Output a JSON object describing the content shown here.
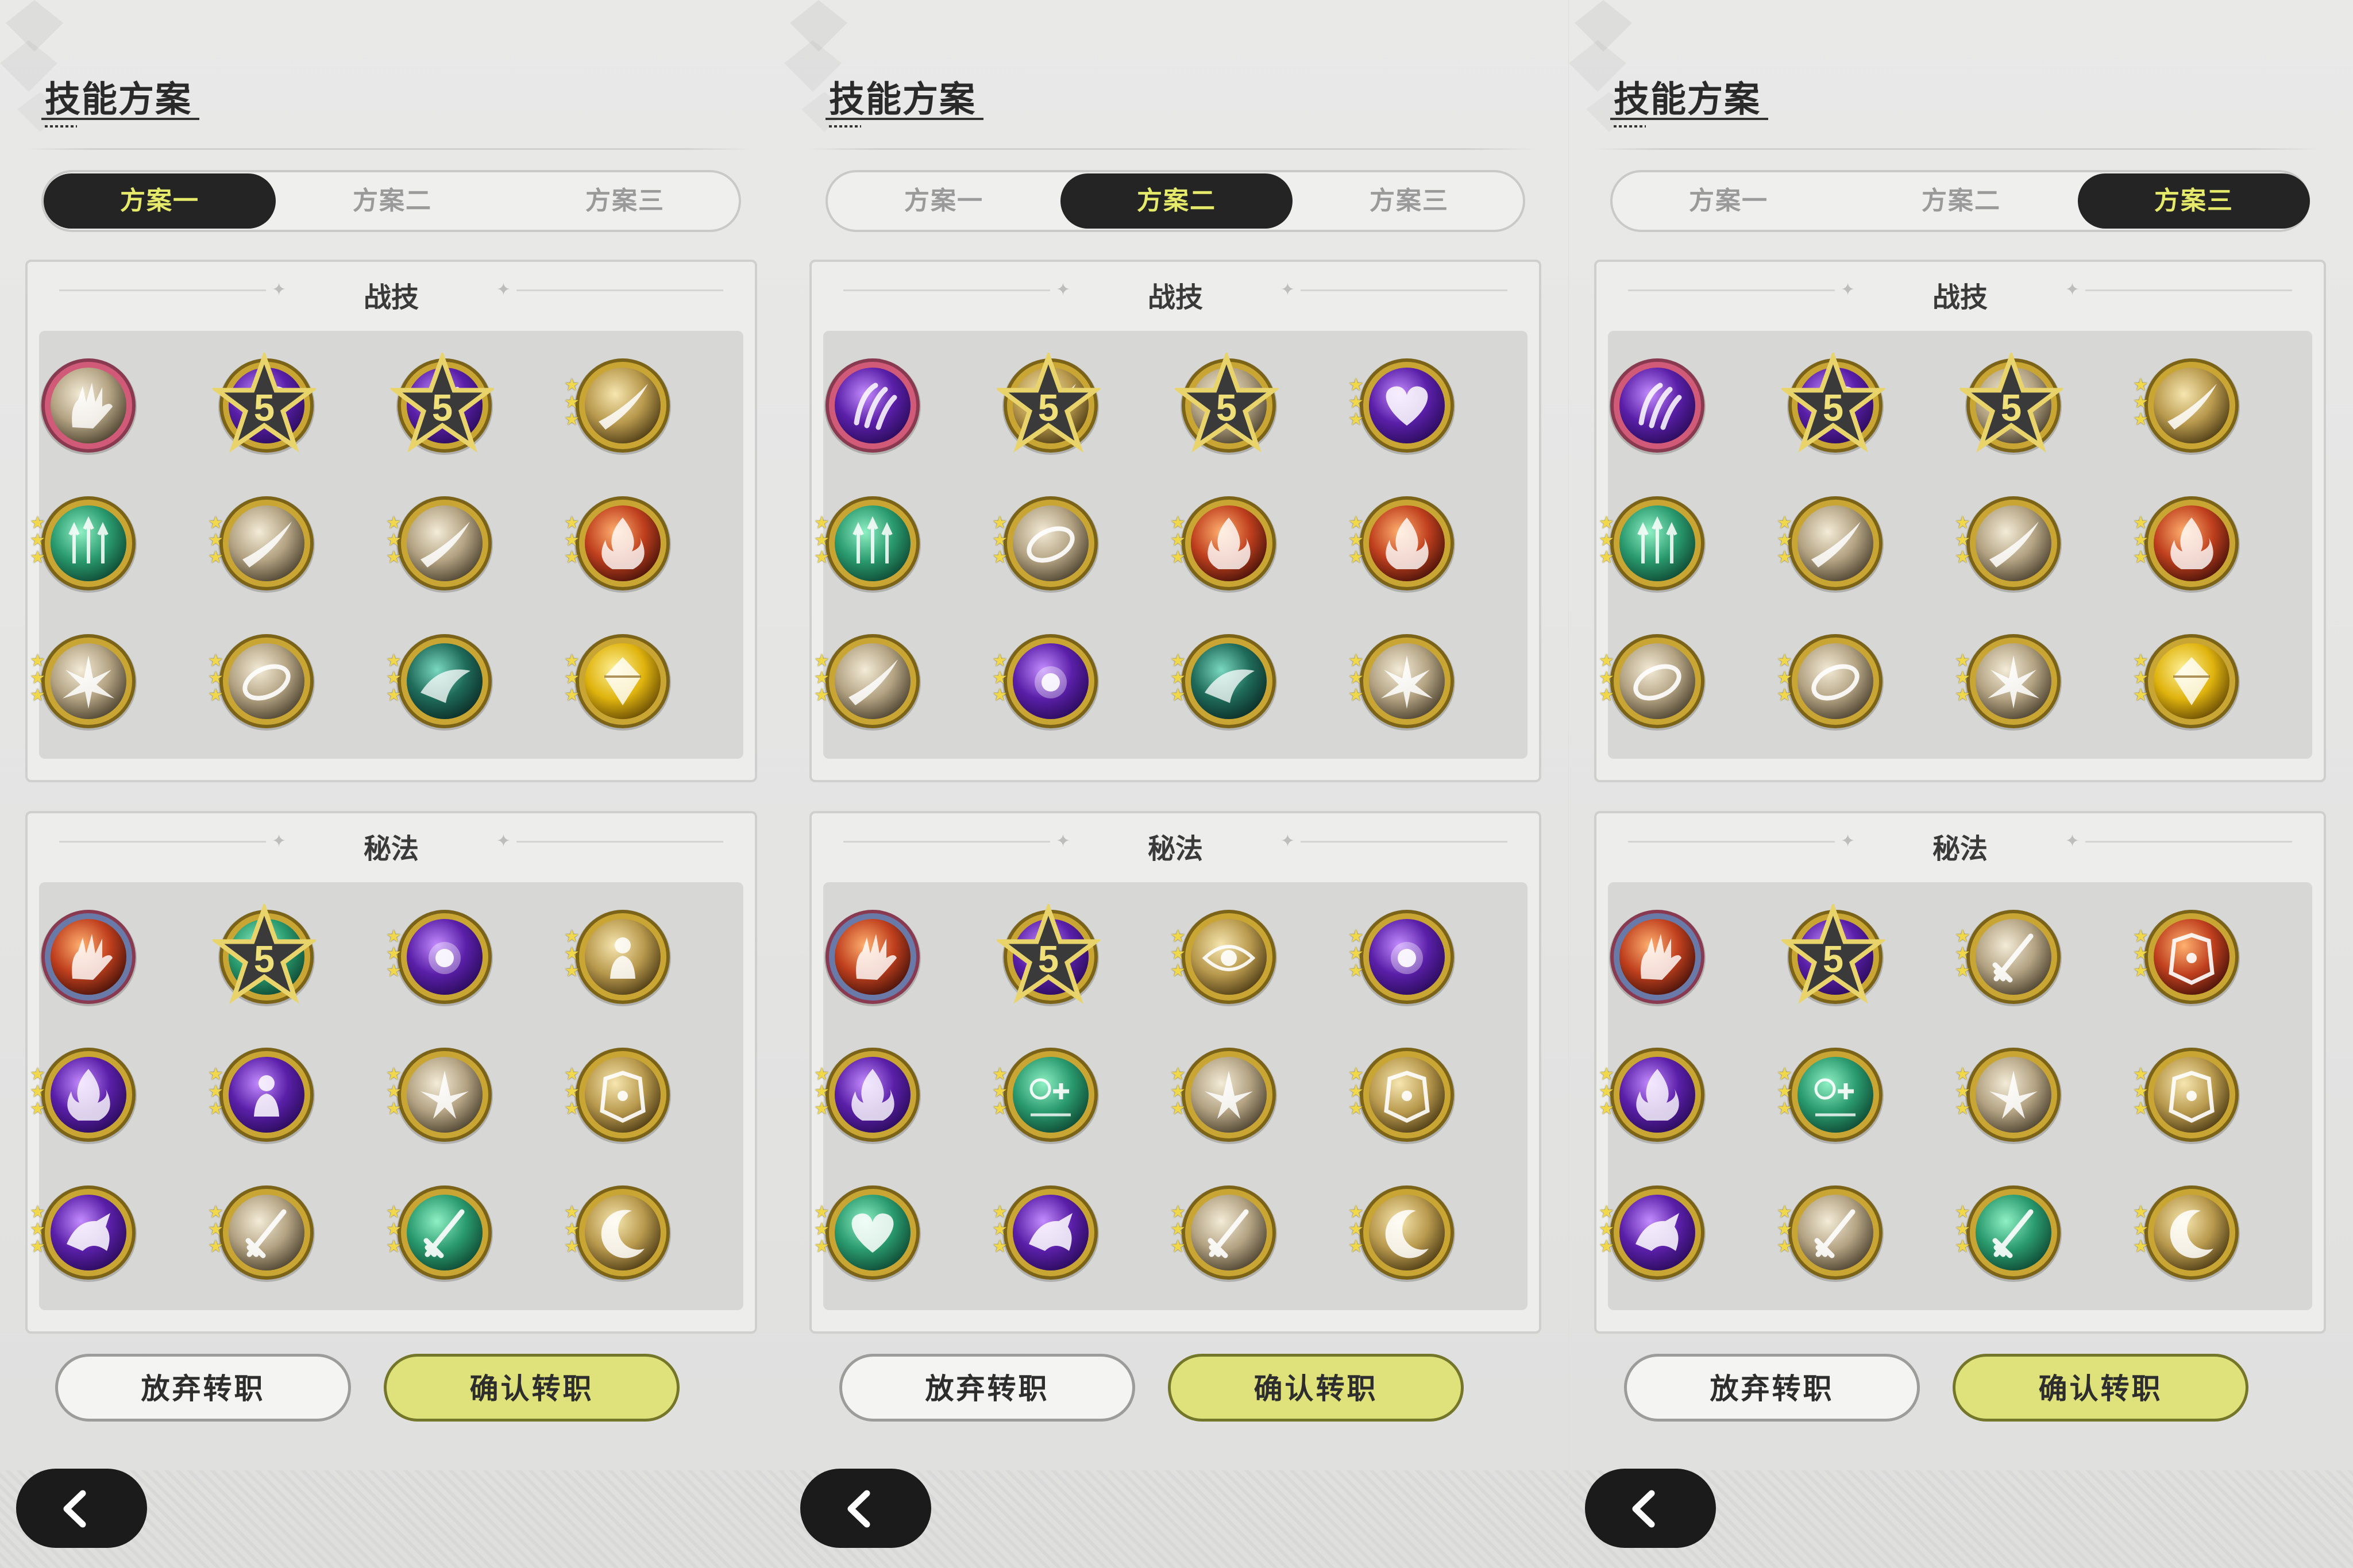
{
  "colors": {
    "tab_active_bg": "#242424",
    "tab_active_text": "#e6ea6a",
    "confirm_bg": "#dfe27a",
    "star": "#f1d84a"
  },
  "panels": [
    {
      "title": "技能方案",
      "tabs": [
        "方案一",
        "方案二",
        "方案三"
      ],
      "active_tab": 0,
      "combat": {
        "title": "战技",
        "icons": [
          "tan-hand-slash-icon",
          "purple-heart-icon",
          "purple-claw-icon",
          "gold-crescent-slash-icon",
          "green-rising-arrows-icon",
          "beige-slash-icon",
          "beige-cross-slash-icon",
          "red-fire-slash-icon",
          "beige-burst-icon",
          "beige-swirl-icon",
          "teal-wave-icon",
          "yellow-gem-icon"
        ],
        "badges": [
          "none",
          "five",
          "five",
          "stars",
          "stars",
          "stars",
          "stars",
          "stars",
          "stars",
          "stars",
          "stars",
          "stars"
        ]
      },
      "arcana": {
        "title": "秘法",
        "icons": [
          "red-hand-icon",
          "green-heal-icon",
          "purple-orb-icon",
          "gold-figure-icon",
          "purple-flame-icon",
          "purple-aura-icon",
          "beige-leaf-icon",
          "gold-armor-icon",
          "purple-beast-icon",
          "beige-sword-icon",
          "green-blade-icon",
          "gold-moon-icon"
        ],
        "badges": [
          "none",
          "five",
          "stars",
          "stars",
          "stars",
          "stars",
          "stars",
          "stars",
          "stars",
          "stars",
          "stars",
          "stars"
        ]
      },
      "buttons": {
        "abandon": "放弃转职",
        "confirm": "确认转职"
      }
    },
    {
      "title": "技能方案",
      "tabs": [
        "方案一",
        "方案二",
        "方案三"
      ],
      "active_tab": 1,
      "combat": {
        "title": "战技",
        "icons": [
          "purple-claw-icon",
          "gold-crescent-slash-icon",
          "tan-hand-slash-icon",
          "purple-heart-icon",
          "green-rising-arrows-icon",
          "beige-ring-slash-icon",
          "red-fire-emblem-icon",
          "red-fire-slash-icon",
          "beige-slash-icon",
          "purple-orb-strike-icon",
          "teal-wave-icon",
          "beige-spikes-icon"
        ],
        "badges": [
          "none",
          "five",
          "five",
          "stars",
          "stars",
          "stars",
          "stars",
          "stars",
          "stars",
          "stars",
          "stars",
          "stars"
        ]
      },
      "arcana": {
        "title": "秘法",
        "icons": [
          "red-hand-icon",
          "purple-aura-icon",
          "gold-eye-icon",
          "purple-orb-icon",
          "purple-flame-icon",
          "green-heal-icon",
          "beige-leaf-icon",
          "gold-armor-icon",
          "green-heart-icon",
          "purple-beast-icon",
          "beige-sword-icon",
          "gold-moon-icon"
        ],
        "badges": [
          "none",
          "five",
          "stars",
          "stars",
          "stars",
          "stars",
          "stars",
          "stars",
          "stars",
          "stars",
          "stars",
          "stars"
        ]
      },
      "buttons": {
        "abandon": "放弃转职",
        "confirm": "确认转职"
      }
    },
    {
      "title": "技能方案",
      "tabs": [
        "方案一",
        "方案二",
        "方案三"
      ],
      "active_tab": 2,
      "combat": {
        "title": "战技",
        "icons": [
          "purple-claw-icon",
          "purple-heart-icon",
          "tan-hand-slash-icon",
          "gold-crescent-slash-icon",
          "green-rising-arrows-icon",
          "beige-slash-icon",
          "beige-cross-slash-icon",
          "red-fire-orb-icon",
          "beige-ring-slash-icon",
          "beige-swirl-icon",
          "beige-spikes-icon",
          "yellow-gem-icon"
        ],
        "badges": [
          "none",
          "five",
          "five",
          "stars",
          "stars",
          "stars",
          "stars",
          "stars",
          "stars",
          "stars",
          "stars",
          "stars"
        ]
      },
      "arcana": {
        "title": "秘法",
        "icons": [
          "red-hand-icon",
          "purple-aura-icon",
          "beige-dagger-icon",
          "red-armor-icon",
          "purple-flame-icon",
          "green-heal-icon",
          "beige-leaf-icon",
          "gold-armor-icon",
          "purple-beast-icon",
          "beige-sword-icon",
          "green-blade-icon",
          "gold-moon-icon"
        ],
        "badges": [
          "none",
          "five",
          "stars",
          "stars",
          "stars",
          "stars",
          "stars",
          "stars",
          "stars",
          "stars",
          "stars",
          "stars"
        ]
      },
      "buttons": {
        "abandon": "放弃转职",
        "confirm": "确认转职"
      }
    }
  ]
}
